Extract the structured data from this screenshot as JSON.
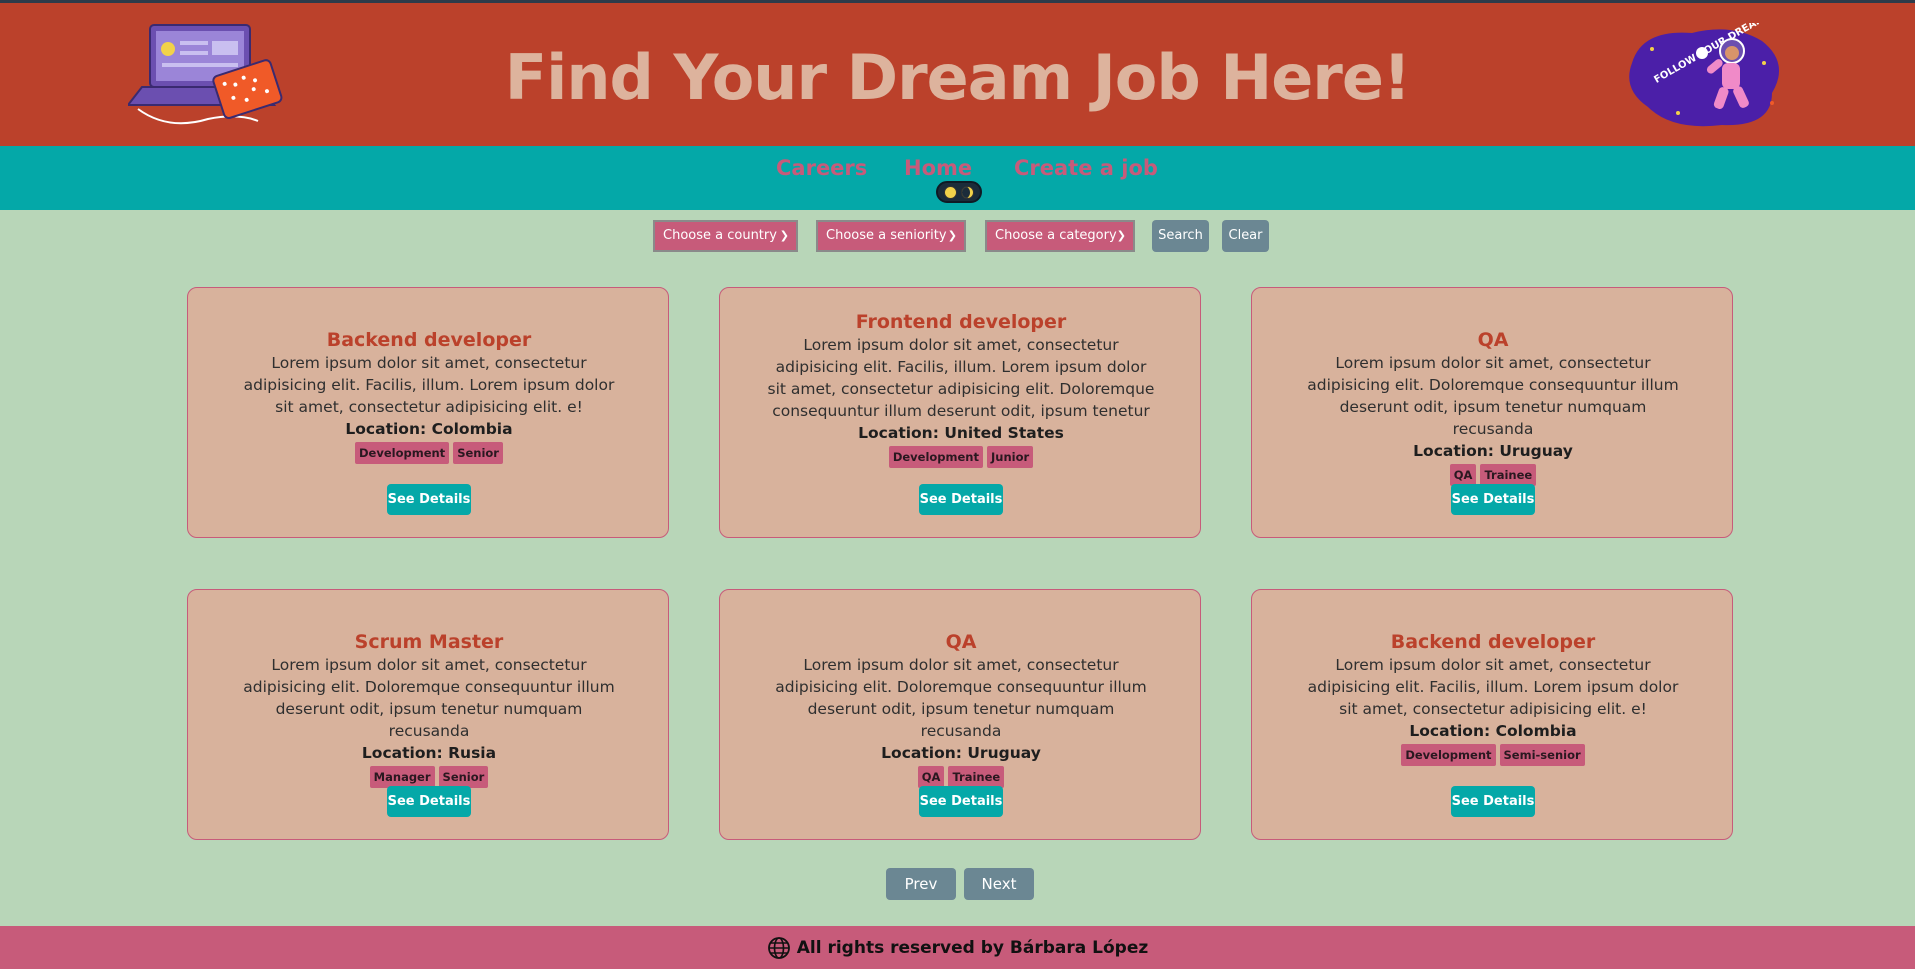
{
  "header": {
    "title": "Find Your Dream Job Here!",
    "sticker_text": "FOLLOW YOUR DREAM!"
  },
  "nav": {
    "links": [
      "Careers",
      "Home",
      "Create a job"
    ]
  },
  "filters": {
    "country_placeholder": "Choose a country",
    "seniority_placeholder": "Choose a seniority",
    "category_placeholder": "Choose a category",
    "search_label": "Search",
    "clear_label": "Clear"
  },
  "jobs": [
    {
      "title": "Backend developer",
      "description": "Lorem ipsum dolor sit amet, consectetur adipisicing elit. Facilis, illum. Lorem ipsum dolor sit amet, consectetur adipisicing elit. e!",
      "location": "Location: Colombia",
      "tags": [
        "Development",
        "Senior"
      ],
      "button": "See Details"
    },
    {
      "title": "Frontend developer",
      "description": "Lorem ipsum dolor sit amet, consectetur adipisicing elit. Facilis, illum. Lorem ipsum dolor sit amet, consectetur adipisicing elit. Doloremque consequuntur illum deserunt odit, ipsum tenetur numquam recusandae",
      "location": "Location: United States",
      "tags": [
        "Development",
        "Junior"
      ],
      "button": "See Details"
    },
    {
      "title": "QA",
      "description": "Lorem ipsum dolor sit amet, consectetur adipisicing elit. Doloremque consequuntur illum deserunt odit, ipsum tenetur numquam recusanda",
      "location": "Location: Uruguay",
      "tags": [
        "QA",
        "Trainee"
      ],
      "button": "See Details"
    },
    {
      "title": "Scrum Master",
      "description": "Lorem ipsum dolor sit amet, consectetur adipisicing elit. Doloremque consequuntur illum deserunt odit, ipsum tenetur numquam recusanda",
      "location": "Location: Rusia",
      "tags": [
        "Manager",
        "Senior"
      ],
      "button": "See Details"
    },
    {
      "title": "QA",
      "description": "Lorem ipsum dolor sit amet, consectetur adipisicing elit. Doloremque consequuntur illum deserunt odit, ipsum tenetur numquam recusanda",
      "location": "Location: Uruguay",
      "tags": [
        "QA",
        "Trainee"
      ],
      "button": "See Details"
    },
    {
      "title": "Backend developer",
      "description": "Lorem ipsum dolor sit amet, consectetur adipisicing elit. Facilis, illum. Lorem ipsum dolor sit amet, consectetur adipisicing elit. e!",
      "location": "Location: Colombia",
      "tags": [
        "Development",
        "Semi-senior"
      ],
      "button": "See Details"
    }
  ],
  "pagination": {
    "prev_label": "Prev",
    "next_label": "Next"
  },
  "footer": {
    "text": "All rights reserved by Bárbara López",
    "icon": "globe-icon"
  },
  "colors": {
    "header_bg": "#bb412b",
    "title_color": "#ddb39d",
    "nav_bg": "#04a8a8",
    "nav_link": "#c75b7a",
    "page_bg": "#b8d6b8",
    "card_bg": "#d8b29c",
    "card_title": "#bb412b",
    "tag_bg": "#c75b7a",
    "button_gray": "#6b8793",
    "footer_bg": "#c75b7a"
  }
}
